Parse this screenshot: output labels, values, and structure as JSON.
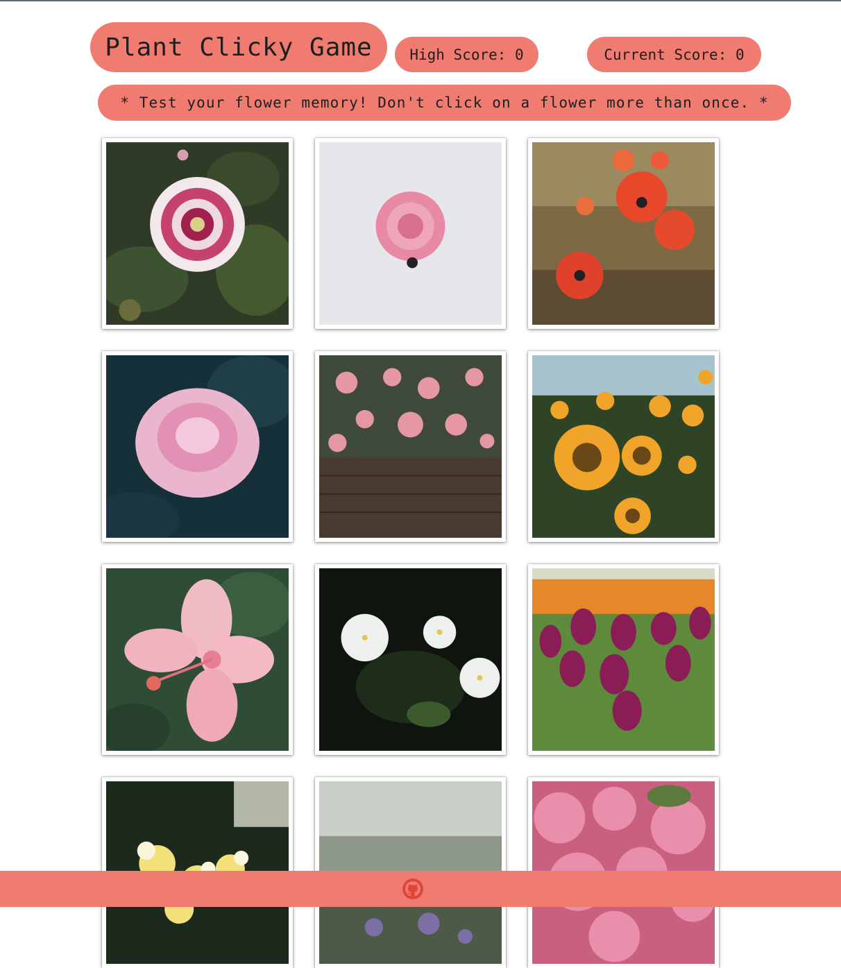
{
  "header": {
    "title": "Plant Clicky Game",
    "high_score": "High Score: 0",
    "current_score": "Current Score: 0",
    "instructions": "* Test your flower memory! Don't click on a flower more than once. *"
  },
  "cards": [
    {
      "icon": "dahlia-image"
    },
    {
      "icon": "pink-rose-image"
    },
    {
      "icon": "red-poppies-image"
    },
    {
      "icon": "pink-peony-image"
    },
    {
      "icon": "camellia-hedge-image"
    },
    {
      "icon": "sunflowers-image"
    },
    {
      "icon": "pink-hibiscus-image"
    },
    {
      "icon": "white-jasmine-image"
    },
    {
      "icon": "purple-tulips-image"
    },
    {
      "icon": "plumeria-image"
    },
    {
      "icon": "wild-grass-image"
    },
    {
      "icon": "pink-hydrangea-image"
    }
  ],
  "footer": {
    "icon": "github-icon"
  },
  "colors": {
    "accent": "#f07b70",
    "github": "#e0453a"
  }
}
